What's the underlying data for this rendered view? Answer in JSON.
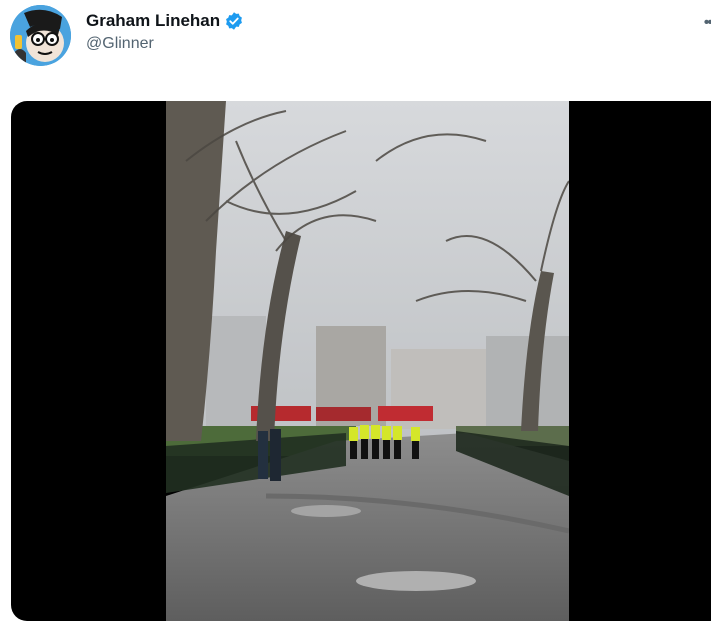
{
  "tweet": {
    "author": {
      "display_name": "Graham Linehan",
      "handle": "@Glinner",
      "verified": true
    },
    "more_icon": "more-horizontal-icon",
    "media": {
      "type": "video"
    }
  },
  "colors": {
    "verified_badge": "#1d9bf0",
    "text_primary": "#0f1419",
    "text_secondary": "#536471",
    "media_background": "#000000"
  }
}
